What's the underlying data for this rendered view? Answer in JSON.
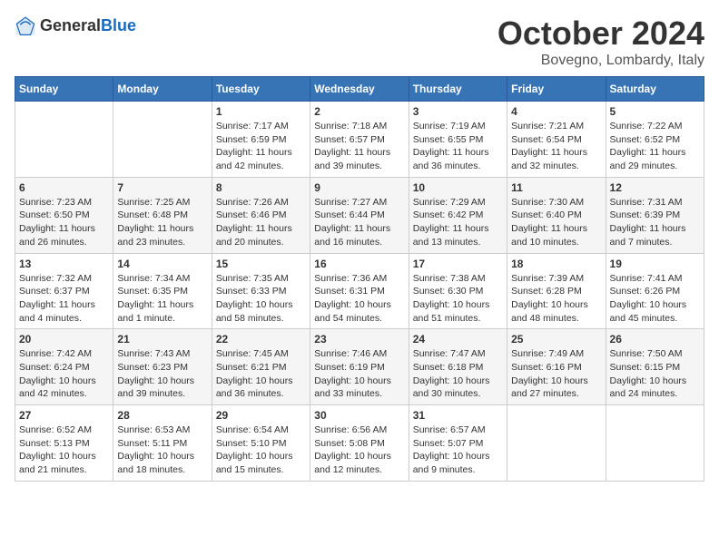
{
  "header": {
    "logo_general": "General",
    "logo_blue": "Blue",
    "month_title": "October 2024",
    "location": "Bovegno, Lombardy, Italy"
  },
  "weekdays": [
    "Sunday",
    "Monday",
    "Tuesday",
    "Wednesday",
    "Thursday",
    "Friday",
    "Saturday"
  ],
  "weeks": [
    [
      {
        "day": "",
        "info": ""
      },
      {
        "day": "",
        "info": ""
      },
      {
        "day": "1",
        "info": "Sunrise: 7:17 AM\nSunset: 6:59 PM\nDaylight: 11 hours and 42 minutes."
      },
      {
        "day": "2",
        "info": "Sunrise: 7:18 AM\nSunset: 6:57 PM\nDaylight: 11 hours and 39 minutes."
      },
      {
        "day": "3",
        "info": "Sunrise: 7:19 AM\nSunset: 6:55 PM\nDaylight: 11 hours and 36 minutes."
      },
      {
        "day": "4",
        "info": "Sunrise: 7:21 AM\nSunset: 6:54 PM\nDaylight: 11 hours and 32 minutes."
      },
      {
        "day": "5",
        "info": "Sunrise: 7:22 AM\nSunset: 6:52 PM\nDaylight: 11 hours and 29 minutes."
      }
    ],
    [
      {
        "day": "6",
        "info": "Sunrise: 7:23 AM\nSunset: 6:50 PM\nDaylight: 11 hours and 26 minutes."
      },
      {
        "day": "7",
        "info": "Sunrise: 7:25 AM\nSunset: 6:48 PM\nDaylight: 11 hours and 23 minutes."
      },
      {
        "day": "8",
        "info": "Sunrise: 7:26 AM\nSunset: 6:46 PM\nDaylight: 11 hours and 20 minutes."
      },
      {
        "day": "9",
        "info": "Sunrise: 7:27 AM\nSunset: 6:44 PM\nDaylight: 11 hours and 16 minutes."
      },
      {
        "day": "10",
        "info": "Sunrise: 7:29 AM\nSunset: 6:42 PM\nDaylight: 11 hours and 13 minutes."
      },
      {
        "day": "11",
        "info": "Sunrise: 7:30 AM\nSunset: 6:40 PM\nDaylight: 11 hours and 10 minutes."
      },
      {
        "day": "12",
        "info": "Sunrise: 7:31 AM\nSunset: 6:39 PM\nDaylight: 11 hours and 7 minutes."
      }
    ],
    [
      {
        "day": "13",
        "info": "Sunrise: 7:32 AM\nSunset: 6:37 PM\nDaylight: 11 hours and 4 minutes."
      },
      {
        "day": "14",
        "info": "Sunrise: 7:34 AM\nSunset: 6:35 PM\nDaylight: 11 hours and 1 minute."
      },
      {
        "day": "15",
        "info": "Sunrise: 7:35 AM\nSunset: 6:33 PM\nDaylight: 10 hours and 58 minutes."
      },
      {
        "day": "16",
        "info": "Sunrise: 7:36 AM\nSunset: 6:31 PM\nDaylight: 10 hours and 54 minutes."
      },
      {
        "day": "17",
        "info": "Sunrise: 7:38 AM\nSunset: 6:30 PM\nDaylight: 10 hours and 51 minutes."
      },
      {
        "day": "18",
        "info": "Sunrise: 7:39 AM\nSunset: 6:28 PM\nDaylight: 10 hours and 48 minutes."
      },
      {
        "day": "19",
        "info": "Sunrise: 7:41 AM\nSunset: 6:26 PM\nDaylight: 10 hours and 45 minutes."
      }
    ],
    [
      {
        "day": "20",
        "info": "Sunrise: 7:42 AM\nSunset: 6:24 PM\nDaylight: 10 hours and 42 minutes."
      },
      {
        "day": "21",
        "info": "Sunrise: 7:43 AM\nSunset: 6:23 PM\nDaylight: 10 hours and 39 minutes."
      },
      {
        "day": "22",
        "info": "Sunrise: 7:45 AM\nSunset: 6:21 PM\nDaylight: 10 hours and 36 minutes."
      },
      {
        "day": "23",
        "info": "Sunrise: 7:46 AM\nSunset: 6:19 PM\nDaylight: 10 hours and 33 minutes."
      },
      {
        "day": "24",
        "info": "Sunrise: 7:47 AM\nSunset: 6:18 PM\nDaylight: 10 hours and 30 minutes."
      },
      {
        "day": "25",
        "info": "Sunrise: 7:49 AM\nSunset: 6:16 PM\nDaylight: 10 hours and 27 minutes."
      },
      {
        "day": "26",
        "info": "Sunrise: 7:50 AM\nSunset: 6:15 PM\nDaylight: 10 hours and 24 minutes."
      }
    ],
    [
      {
        "day": "27",
        "info": "Sunrise: 6:52 AM\nSunset: 5:13 PM\nDaylight: 10 hours and 21 minutes."
      },
      {
        "day": "28",
        "info": "Sunrise: 6:53 AM\nSunset: 5:11 PM\nDaylight: 10 hours and 18 minutes."
      },
      {
        "day": "29",
        "info": "Sunrise: 6:54 AM\nSunset: 5:10 PM\nDaylight: 10 hours and 15 minutes."
      },
      {
        "day": "30",
        "info": "Sunrise: 6:56 AM\nSunset: 5:08 PM\nDaylight: 10 hours and 12 minutes."
      },
      {
        "day": "31",
        "info": "Sunrise: 6:57 AM\nSunset: 5:07 PM\nDaylight: 10 hours and 9 minutes."
      },
      {
        "day": "",
        "info": ""
      },
      {
        "day": "",
        "info": ""
      }
    ]
  ]
}
